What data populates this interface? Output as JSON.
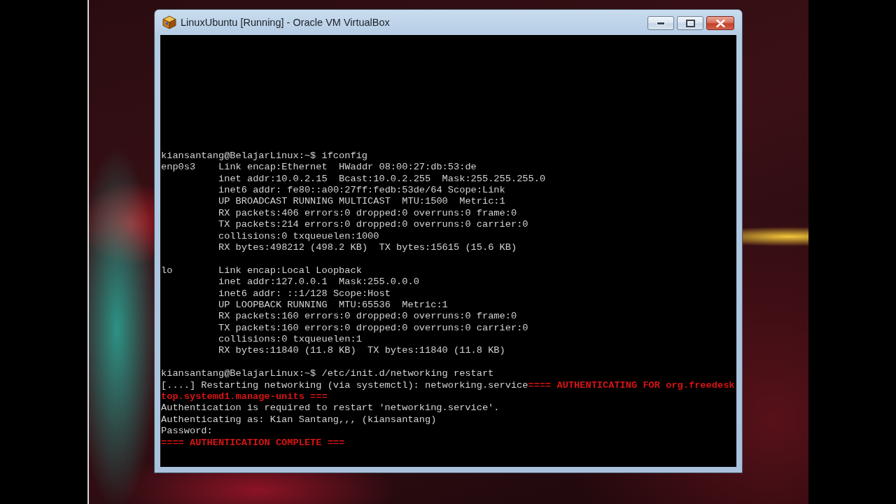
{
  "window": {
    "title": "LinuxUbuntu [Running] - Oracle VM VirtualBox"
  },
  "terminal": {
    "entries": [
      {
        "kind": "line",
        "segments": [
          {
            "text": "kiansantang@BelajarLinux:~$ ifconfig",
            "alert": false
          }
        ]
      },
      {
        "kind": "interface",
        "name": "enp0s3",
        "lines": [
          "Link encap:Ethernet  HWaddr 08:00:27:db:53:de",
          "inet addr:10.0.2.15  Bcast:10.0.2.255  Mask:255.255.255.0",
          "inet6 addr: fe80::a00:27ff:fedb:53de/64 Scope:Link",
          "UP BROADCAST RUNNING MULTICAST  MTU:1500  Metric:1",
          "RX packets:406 errors:0 dropped:0 overruns:0 frame:0",
          "TX packets:214 errors:0 dropped:0 overruns:0 carrier:0",
          "collisions:0 txqueuelen:1000",
          "RX bytes:498212 (498.2 KB)  TX bytes:15615 (15.6 KB)"
        ]
      },
      {
        "kind": "interface",
        "name": "lo",
        "lines": [
          "Link encap:Local Loopback",
          "inet addr:127.0.0.1  Mask:255.0.0.0",
          "inet6 addr: ::1/128 Scope:Host",
          "UP LOOPBACK RUNNING  MTU:65536  Metric:1",
          "RX packets:160 errors:0 dropped:0 overruns:0 frame:0",
          "TX packets:160 errors:0 dropped:0 overruns:0 carrier:0",
          "collisions:0 txqueuelen:1",
          "RX bytes:11840 (11.8 KB)  TX bytes:11840 (11.8 KB)"
        ]
      },
      {
        "kind": "line",
        "segments": [
          {
            "text": "kiansantang@BelajarLinux:~$ /etc/init.d/networking restart",
            "alert": false
          }
        ]
      },
      {
        "kind": "line",
        "segments": [
          {
            "text": "[....] Restarting networking (via systemctl): networking.service",
            "alert": false
          },
          {
            "text": "==== AUTHENTICATING FOR org.freedesk",
            "alert": true
          }
        ]
      },
      {
        "kind": "line",
        "segments": [
          {
            "text": "top.systemd1.manage-units ===",
            "alert": true
          }
        ]
      },
      {
        "kind": "line",
        "segments": [
          {
            "text": "Authentication is required to restart 'networking.service'.",
            "alert": false
          }
        ]
      },
      {
        "kind": "line",
        "segments": [
          {
            "text": "Authenticating as: Kian Santang,,, (kiansantang)",
            "alert": false
          }
        ]
      },
      {
        "kind": "line",
        "segments": [
          {
            "text": "Password:",
            "alert": false
          }
        ]
      },
      {
        "kind": "line",
        "segments": [
          {
            "text": "==== AUTHENTICATION COMPLETE ===",
            "alert": true
          }
        ]
      }
    ]
  }
}
